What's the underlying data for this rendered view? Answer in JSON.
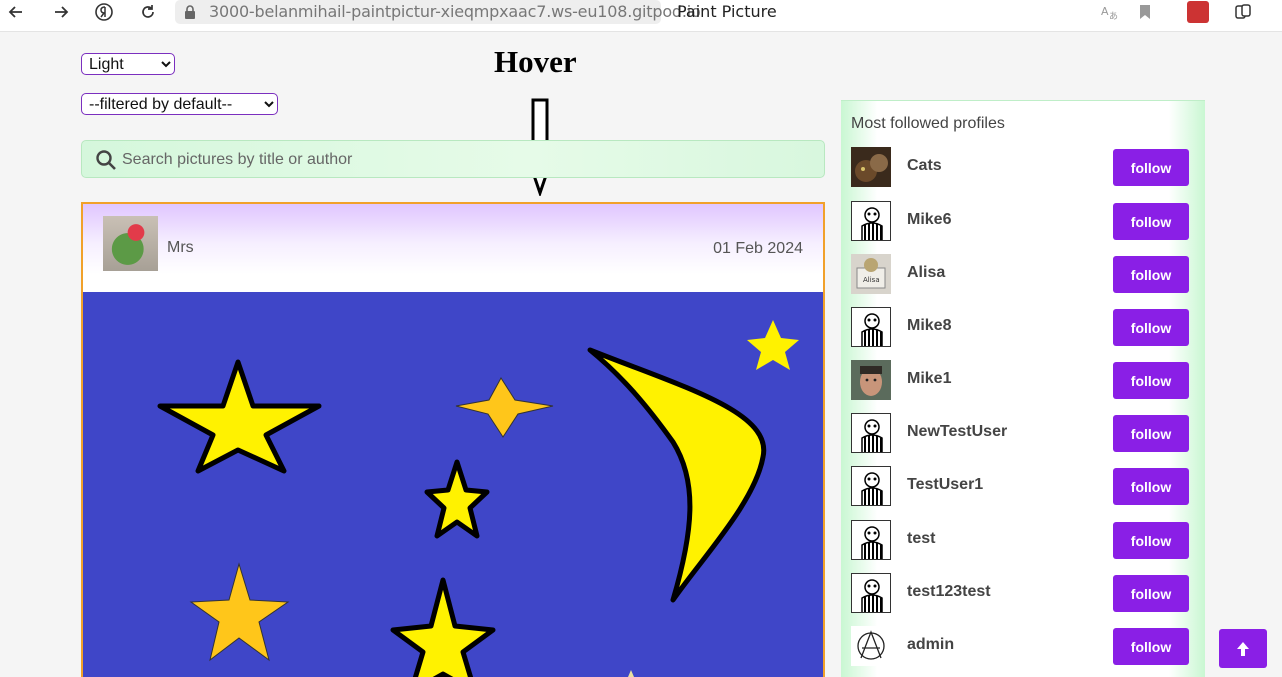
{
  "browser": {
    "url": "3000-belanmihail-paintpictur-xieqmpxaac7.ws-eu108.gitpod.io",
    "tab_title": "Paint Picture"
  },
  "controls": {
    "theme_selected": "Light",
    "filter_selected": "--filtered by default--",
    "hover_title": "Hover",
    "search_placeholder": "Search pictures by title or author"
  },
  "card": {
    "author": "Mrs",
    "date": "01 Feb 2024"
  },
  "sidebar": {
    "title": "Most followed profiles",
    "follow_label": "follow",
    "profiles": [
      {
        "name": "Cats",
        "avatar": "cat-photo"
      },
      {
        "name": "Mike6",
        "avatar": "striped-figure"
      },
      {
        "name": "Alisa",
        "avatar": "alisa-photo"
      },
      {
        "name": "Mike8",
        "avatar": "striped-figure"
      },
      {
        "name": "Mike1",
        "avatar": "man-photo"
      },
      {
        "name": "NewTestUser",
        "avatar": "striped-figure"
      },
      {
        "name": "TestUser1",
        "avatar": "striped-figure"
      },
      {
        "name": "test",
        "avatar": "striped-figure"
      },
      {
        "name": "test123test",
        "avatar": "striped-figure"
      },
      {
        "name": "admin",
        "avatar": "anarchy-symbol"
      }
    ]
  },
  "scroll_top_icon": "arrow-up-icon"
}
